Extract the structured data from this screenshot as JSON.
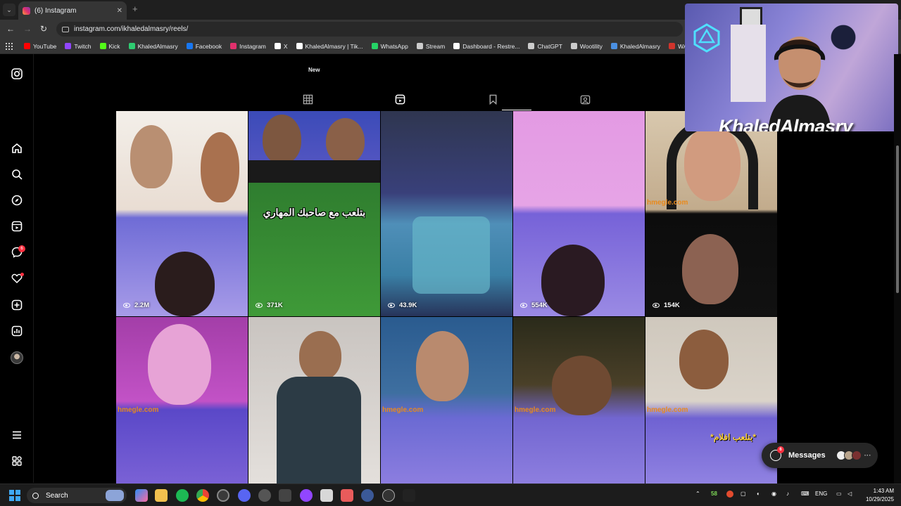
{
  "browser": {
    "tab_title": "(6) Instagram",
    "url": "instagram.com/ikhaledalmasry/reels/",
    "bookmarks": [
      {
        "label": "YouTube",
        "color": "#ff0000"
      },
      {
        "label": "Twitch",
        "color": "#9146ff"
      },
      {
        "label": "Kick",
        "color": "#53fc18"
      },
      {
        "label": "KhaledAlmasry",
        "color": "#2ecc71"
      },
      {
        "label": "Facebook",
        "color": "#1877f2"
      },
      {
        "label": "Instagram",
        "color": "#e1306c"
      },
      {
        "label": "X",
        "color": "#ffffff"
      },
      {
        "label": "KhaledAlmasry | Tik...",
        "color": "#ffffff"
      },
      {
        "label": "WhatsApp",
        "color": "#25d366"
      },
      {
        "label": "Stream",
        "color": "#cccccc"
      },
      {
        "label": "Dashboard - Restre...",
        "color": "#ffffff"
      },
      {
        "label": "ChatGPT",
        "color": "#cccccc"
      },
      {
        "label": "Wootility",
        "color": "#cccccc"
      },
      {
        "label": "KhaledAlmasry",
        "color": "#4a90e2"
      },
      {
        "label": "WARZONE",
        "color": "#d0342c"
      }
    ]
  },
  "instagram": {
    "notifications_badge": "6",
    "highlight_label": "New",
    "reels": [
      {
        "views": "2.2M"
      },
      {
        "views": "371K",
        "caption": "بتلعب مع صاحبك المهاري"
      },
      {
        "views": "43.9K"
      },
      {
        "views": "554K"
      },
      {
        "views": "154K"
      }
    ],
    "second_row_caption": "*بتلعب افلام*",
    "omegle_text": "hmegle.com",
    "messages": {
      "label": "Messages",
      "badge": "6"
    }
  },
  "webcam": {
    "name": "KhaledAlmasry"
  },
  "taskbar": {
    "search_label": "Search",
    "tray_number": "58",
    "language": "ENG",
    "time": "1:43 AM",
    "date": "10/29/2025"
  }
}
